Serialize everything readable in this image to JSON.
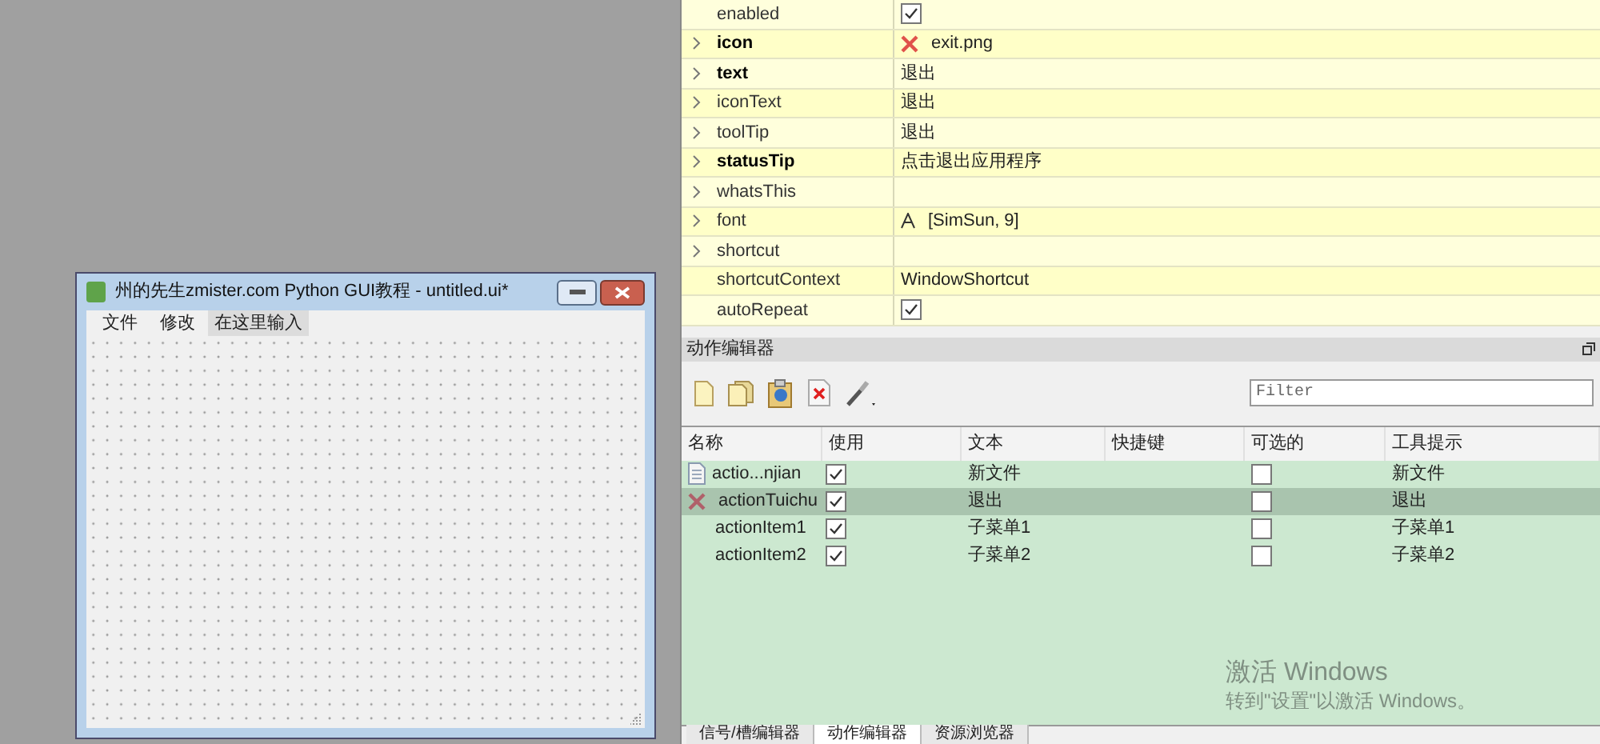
{
  "designer_window": {
    "title": "州的先生zmister.com Python GUI教程 - untitled.ui*",
    "menus": [
      {
        "label": "文件",
        "kind": "menu"
      },
      {
        "label": "修改",
        "kind": "menu"
      },
      {
        "label": "在这里输入",
        "kind": "placeholder"
      }
    ]
  },
  "property_editor": {
    "rows": [
      {
        "name": "enabled",
        "expandable": false,
        "modified": false,
        "kind": "checkbox",
        "checked": true
      },
      {
        "name": "icon",
        "expandable": true,
        "modified": true,
        "kind": "icon",
        "value": "exit.png"
      },
      {
        "name": "text",
        "expandable": true,
        "modified": true,
        "kind": "text",
        "value": "退出"
      },
      {
        "name": "iconText",
        "expandable": true,
        "modified": false,
        "kind": "text",
        "value": "退出"
      },
      {
        "name": "toolTip",
        "expandable": true,
        "modified": false,
        "kind": "text",
        "value": "退出"
      },
      {
        "name": "statusTip",
        "expandable": true,
        "modified": true,
        "kind": "text",
        "value": "点击退出应用程序"
      },
      {
        "name": "whatsThis",
        "expandable": true,
        "modified": false,
        "kind": "text"
      },
      {
        "name": "font",
        "expandable": true,
        "modified": false,
        "kind": "font",
        "value": "[SimSun, 9]"
      },
      {
        "name": "shortcut",
        "expandable": true,
        "modified": false,
        "kind": "text"
      },
      {
        "name": "shortcutContext",
        "expandable": false,
        "modified": false,
        "kind": "text",
        "value": "WindowShortcut"
      },
      {
        "name": "autoRepeat",
        "expandable": false,
        "modified": false,
        "kind": "checkbox",
        "checked": true
      }
    ]
  },
  "action_editor": {
    "title": "动作编辑器",
    "filter": {
      "placeholder": "Filter"
    },
    "columns": [
      "名称",
      "使用",
      "文本",
      "快捷键",
      "可选的",
      "工具提示"
    ],
    "rows": [
      {
        "name": "actio...njian",
        "kind": "document",
        "used": true,
        "text": "新文件",
        "checkable": false,
        "tooltip": "新文件",
        "selected": false
      },
      {
        "name": "actionTuichu",
        "kind": "exit",
        "used": true,
        "text": "退出",
        "checkable": false,
        "tooltip": "退出",
        "selected": true
      },
      {
        "name": "actionItem1",
        "kind": "plain",
        "used": true,
        "text": "子菜单1",
        "checkable": false,
        "tooltip": "子菜单1",
        "selected": false
      },
      {
        "name": "actionItem2",
        "kind": "plain",
        "used": true,
        "text": "子菜单2",
        "checkable": false,
        "tooltip": "子菜单2",
        "selected": false
      }
    ]
  },
  "activation_notice": {
    "title": "激活 Windows",
    "message": "转到\"设置\"以激活 Windows。"
  },
  "bottom_tabs": [
    {
      "label": "信号/槽编辑器",
      "selected": false
    },
    {
      "label": "动作编辑器",
      "selected": true
    },
    {
      "label": "资源浏览器",
      "selected": false
    }
  ]
}
